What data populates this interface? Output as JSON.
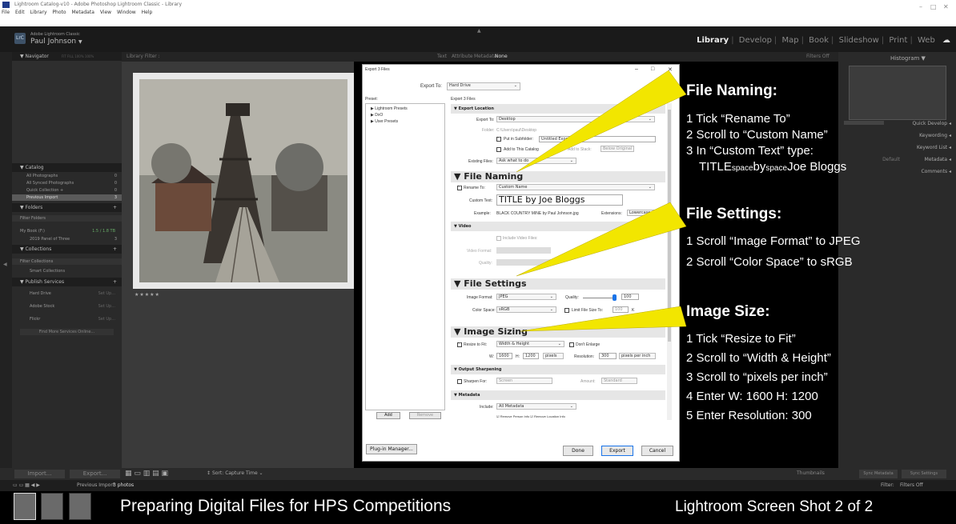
{
  "window": {
    "title": "Lightroom Catalog-v10 - Adobe Photoshop Lightroom Classic - Library",
    "menu": [
      "File",
      "Edit",
      "Library",
      "Photo",
      "Metadata",
      "View",
      "Window",
      "Help"
    ],
    "controls": [
      "–",
      "□",
      "✕"
    ]
  },
  "lr": {
    "brand_small": "Adobe Lightroom Classic",
    "user": "Paul Johnson",
    "logo": "LrC",
    "modules": [
      "Library",
      "Develop",
      "Map",
      "Book",
      "Slideshow",
      "Print",
      "Web"
    ],
    "active_module": "Library"
  },
  "left_panel": {
    "navigator": "Navigator",
    "navigator_opts": "FIT   FILL   100%   100%",
    "catalog": "Catalog",
    "catalog_items": [
      {
        "label": "All Photographs",
        "count": "0"
      },
      {
        "label": "All Synced Photographs",
        "count": "0"
      },
      {
        "label": "Quick Collection +",
        "count": "0"
      },
      {
        "label": "Previous Import",
        "count": "3"
      }
    ],
    "folders": "Folders",
    "filter_folders": "Filter Folders",
    "folder_drive": "My Book (F:)",
    "folder_drive_size": "1.5 / 1.8 TB",
    "folder_item": "2019 Panel of Three",
    "folder_item_count": "3",
    "collections": "Collections",
    "filter_collections": "Filter Collections",
    "smart_collections": "Smart Collections",
    "publish": "Publish Services",
    "publish_items": [
      {
        "label": "Hard Drive",
        "action": "Set Up..."
      },
      {
        "label": "Adobe Stock",
        "action": "Set Up..."
      },
      {
        "label": "Flickr",
        "action": "Set Up..."
      }
    ],
    "find_more": "Find More Services Online..."
  },
  "filter_bar": {
    "title": "Library Filter :",
    "options": [
      "Text",
      "Attribute",
      "Metadata",
      "None"
    ],
    "right": "Filters Off"
  },
  "photo": {
    "rating": "★★★★★"
  },
  "dialog": {
    "title": "Export 3 Files",
    "export_to_label": "Export To:",
    "export_to_value": "Hard Drive",
    "preset_label": "Preset:",
    "subtitle": "Export 3 Files",
    "presets": [
      "Lightroom Presets",
      "DxO",
      "User Presets"
    ],
    "sect_location": "Export Location",
    "loc_export_to_label": "Export To:",
    "loc_export_to": "Desktop",
    "loc_folder_label": "Folder:",
    "loc_folder": "C:\\Users\\paul\\Desktop",
    "loc_subfolder": "Put in Subfolder:",
    "loc_subfolder_value": "Untitled Export",
    "loc_add_catalog": "Add to This Catalog",
    "loc_add_stack": "Add to Stack:",
    "loc_stack_value": "Below Original",
    "loc_existing_label": "Existing Files:",
    "loc_existing": "Ask what to do",
    "sect_naming": "File Naming",
    "rename_label": "Rename To:",
    "rename_value": "Custom Name",
    "custom_text_label": "Custom Text:",
    "custom_text_value": "TITLE by Joe Bloggs",
    "example_label": "Example:",
    "example_value": "BLACK COUNTRY MINE by Paul Johnson.jpg",
    "extensions_label": "Extensions:",
    "extensions_value": "Lowercase",
    "sect_video": "Video",
    "include_video": "Include Video Files:",
    "video_format": "Video Format:",
    "quality_label": "Quality:",
    "sect_settings": "File Settings",
    "image_format_label": "Image Format:",
    "image_format": "JPEG",
    "jpeg_quality_label": "Quality:",
    "jpeg_quality": "100",
    "color_space_label": "Color Space:",
    "color_space": "sRGB",
    "limit_size": "Limit File Size To:",
    "limit_value": "100",
    "limit_unit": "K",
    "sect_sizing": "Image Sizing",
    "resize_label": "Resize to Fit:",
    "resize_value": "Width & Height",
    "dont_enlarge": "Don't Enlarge",
    "w_label": "W:",
    "w_value": "1600",
    "h_label": "H:",
    "h_value": "1200",
    "units": "pixels",
    "resolution_label": "Resolution:",
    "resolution_value": "300",
    "resolution_unit": "pixels per inch",
    "sect_sharpen": "Output Sharpening",
    "sharpen_label": "Sharpen For:",
    "sharpen_value": "Screen",
    "amount_label": "Amount:",
    "amount_value": "Standard",
    "sect_metadata": "Metadata",
    "include_label": "Include:",
    "include_value": "All Metadata",
    "remove_person": "Remove Person Info",
    "remove_location": "Remove Location Info",
    "add_btn": "Add",
    "remove_btn": "Remove",
    "plugin_btn": "Plug-in Manager...",
    "done_btn": "Done",
    "export_btn": "Export",
    "cancel_btn": "Cancel"
  },
  "right_panel": {
    "histogram": "Histogram",
    "items": [
      "Quick Develop",
      "Keywording",
      "Keyword List",
      "Metadata",
      "Comments"
    ],
    "default_label": "Default"
  },
  "toolbar": {
    "import": "Import...",
    "export": "Export...",
    "sort_label": "Sort:",
    "sort_value": "Capture Time",
    "thumbnails": "Thumbnails",
    "sync_metadata": "Sync Metadata",
    "sync_settings": "Sync Settings"
  },
  "filmstrip": {
    "source": "Previous Import",
    "count": "3 photos",
    "filter_label": "Filter:",
    "filter_value": "Filters Off"
  },
  "annotations": {
    "naming_title": "File Naming:",
    "naming_1": "1 Tick “Rename To”",
    "naming_2": "2 Scroll to “Custom Name”",
    "naming_3": "3 In “Custom Text” type:",
    "naming_4a": "TITLE",
    "naming_4b": "space",
    "naming_4c": "by",
    "naming_4d": "space",
    "naming_4e": "Joe Bloggs",
    "settings_title": "File Settings:",
    "settings_1": "1 Scroll “Image Format” to JPEG",
    "settings_2": "2 Scroll “Color Space” to sRGB",
    "size_title": "Image Size:",
    "size_1": "1 Tick “Resize to Fit”",
    "size_2": "2 Scroll to “Width & Height”",
    "size_3": "3 Scroll to “pixels per inch”",
    "size_4": "4 Enter W: 1600  H: 1200",
    "size_5": "5 Enter Resolution: 300"
  },
  "footer": {
    "left": "Preparing Digital Files for HPS Competitions",
    "right": "Lightroom Screen Shot 2 of 2"
  },
  "colors": {
    "callout": "#f2e600",
    "dark": "#000000",
    "panel": "#2a2a2a"
  }
}
